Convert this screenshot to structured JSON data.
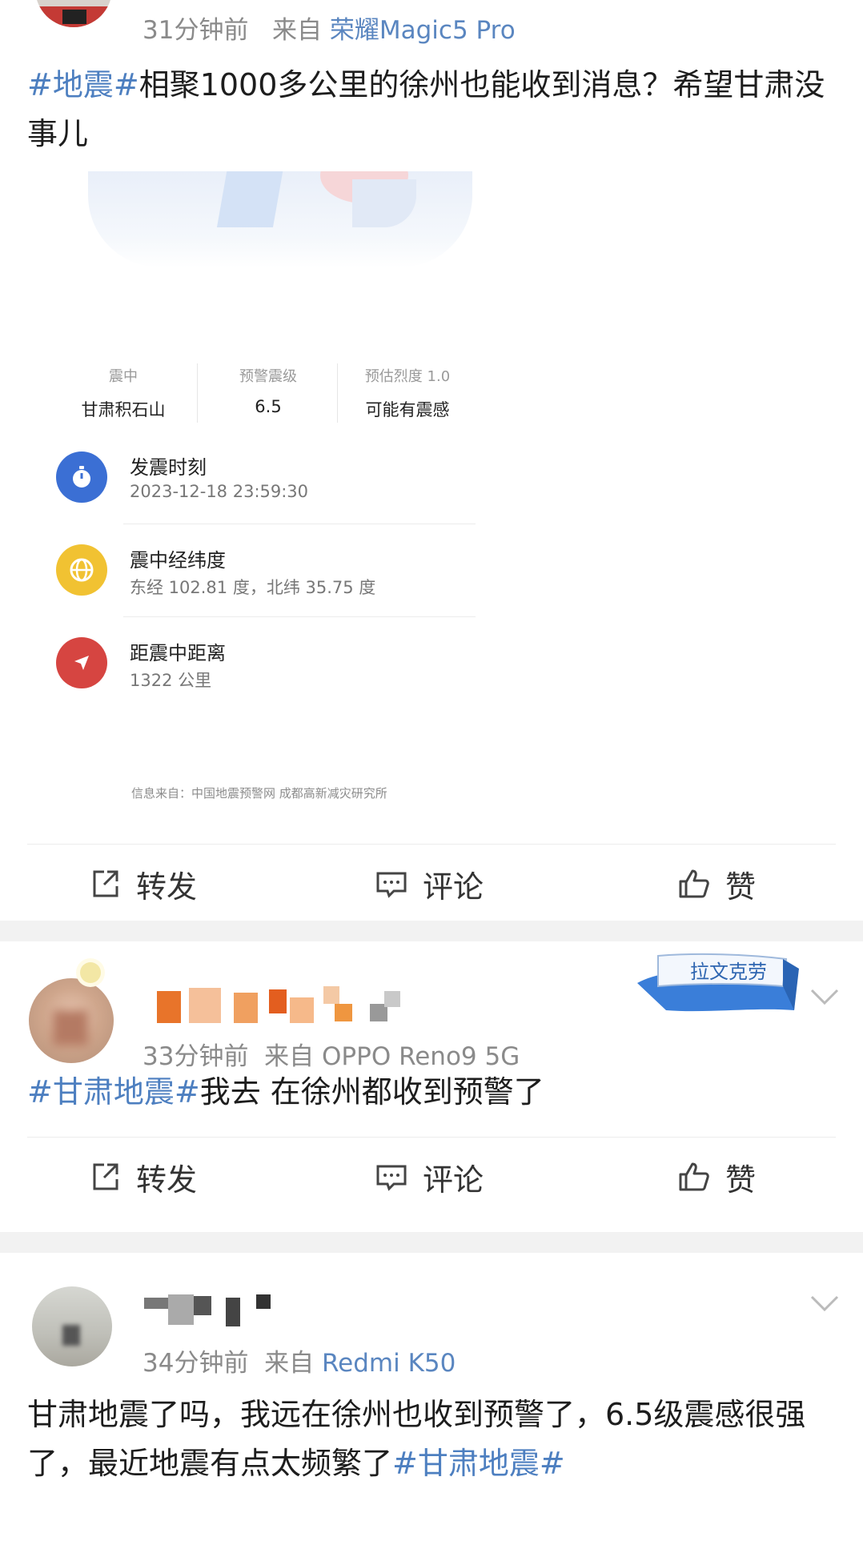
{
  "post1": {
    "time": "31分钟前",
    "from": "来自",
    "device": "荣耀Magic5 Pro",
    "tag": "#地震#",
    "text": "相聚1000多公里的徐州也能收到消息？希望甘肃没事儿",
    "card": {
      "stats": [
        {
          "label": "震中",
          "value": "甘肃积石山"
        },
        {
          "label": "预警震级",
          "value": "6.5"
        },
        {
          "label": "预估烈度 1.0",
          "value": "可能有震感"
        }
      ],
      "rows": [
        {
          "icon": "stopwatch-icon",
          "title": "发震时刻",
          "sub": "2023-12-18 23:59:30",
          "color": "#3b6fd4"
        },
        {
          "icon": "globe-icon",
          "title": "震中经纬度",
          "sub": "东经 102.81 度，北纬 35.75 度",
          "color": "#f1c232"
        },
        {
          "icon": "navigation-icon",
          "title": "距震中距离",
          "sub": "1322 公里",
          "color": "#d64541"
        }
      ],
      "source": "信息来自：中国地震预警网 成都高新减灾研究所"
    },
    "actions": {
      "repost": "转发",
      "comment": "评论",
      "like": "赞"
    }
  },
  "post2": {
    "time": "33分钟前",
    "from": "来自",
    "device": "OPPO Reno9 5G",
    "ribbon": "拉文克劳",
    "tag": "#甘肃地震#",
    "text": "我去 在徐州都收到预警了",
    "actions": {
      "repost": "转发",
      "comment": "评论",
      "like": "赞"
    }
  },
  "post3": {
    "time": "34分钟前",
    "from": "来自",
    "device": "Redmi K50",
    "text": "甘肃地震了吗，我远在徐州也收到预警了，6.5级震感很强了，最近地震有点太频繁了",
    "tag": "#甘肃地震#"
  },
  "colors": {
    "tag": "#4d7fc0",
    "source": "#5a86c0",
    "separator": "#f2f2f2"
  }
}
